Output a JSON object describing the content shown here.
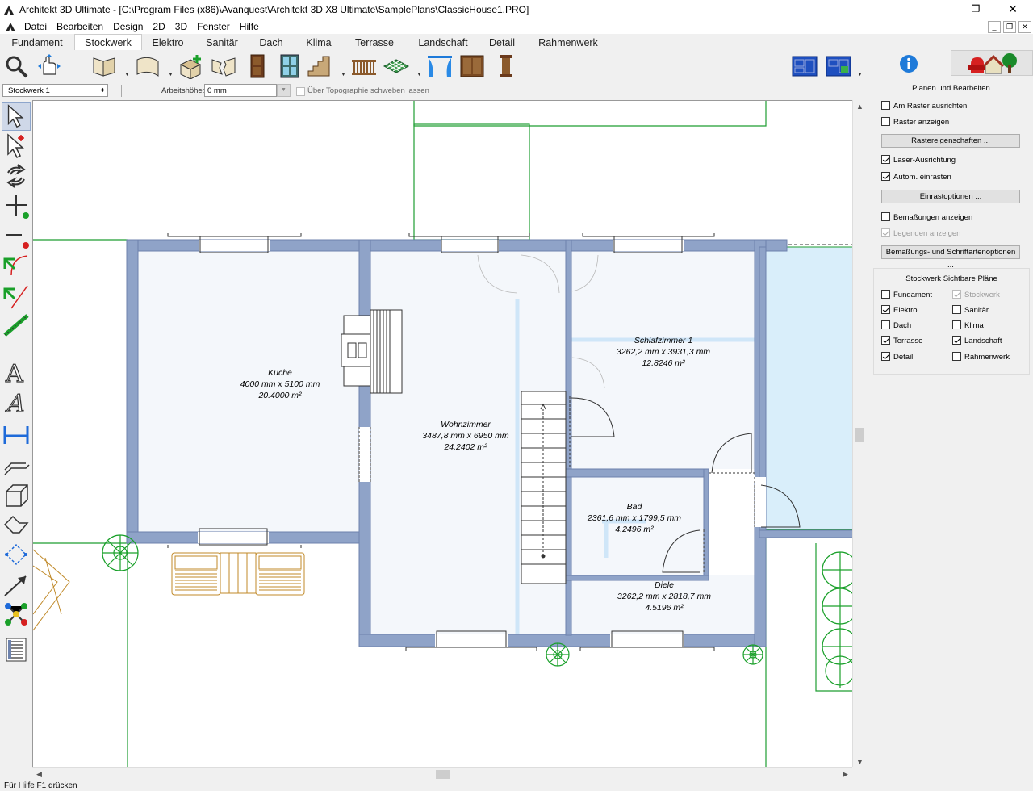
{
  "window": {
    "title": "Architekt 3D Ultimate - [C:\\Program Files (x86)\\Avanquest\\Architekt 3D X8 Ultimate\\SamplePlans\\ClassicHouse1.PRO]",
    "minimize": "—",
    "maximize": "❐",
    "close": "✕"
  },
  "menu": [
    "Datei",
    "Bearbeiten",
    "Design",
    "2D",
    "3D",
    "Fenster",
    "Hilfe"
  ],
  "tabs": [
    {
      "label": "Fundament",
      "active": false
    },
    {
      "label": "Stockwerk",
      "active": true
    },
    {
      "label": "Elektro",
      "active": false
    },
    {
      "label": "Sanitär",
      "active": false
    },
    {
      "label": "Dach",
      "active": false
    },
    {
      "label": "Klima",
      "active": false
    },
    {
      "label": "Terrasse",
      "active": false
    },
    {
      "label": "Landschaft",
      "active": false
    },
    {
      "label": "Detail",
      "active": false
    },
    {
      "label": "Rahmenwerk",
      "active": false
    }
  ],
  "options": {
    "floor_select": "Stockwerk 1",
    "height_label": "Arbeitshöhe:",
    "height_value": "0 mm",
    "topo_label": "Über Topographie schweben lassen"
  },
  "rooms": [
    {
      "name": "Küche",
      "size": "4000 mm x 5100 mm",
      "area": "20.4000 m²"
    },
    {
      "name": "Wohnzimmer",
      "size": "3487,8 mm x 6950 mm",
      "area": "24.2402 m²"
    },
    {
      "name": "Schlafzimmer 1",
      "size": "3262,2 mm x 3931,3 mm",
      "area": "12.8246 m²"
    },
    {
      "name": "Bad",
      "size": "2361,6 mm x 1799,5 mm",
      "area": "4.2496 m²"
    },
    {
      "name": "Diele",
      "size": "3262,2 mm x 2818,7 mm",
      "area": "4.5196 m²"
    }
  ],
  "panel": {
    "section_title": "Planen und Bearbeiten",
    "snap_grid": {
      "label": "Am Raster ausrichten",
      "checked": false
    },
    "show_grid": {
      "label": "Raster anzeigen",
      "checked": false
    },
    "grid_props_btn": "Rastereigenschaften ...",
    "laser": {
      "label": "Laser-Ausrichtung",
      "checked": true
    },
    "auto_snap": {
      "label": "Autom. einrasten",
      "checked": true
    },
    "snap_opts_btn": "Einrastoptionen ...",
    "show_dims": {
      "label": "Bemaßungen anzeigen",
      "checked": false
    },
    "show_legends": {
      "label": "Legenden anzeigen",
      "checked": true
    },
    "dim_font_btn": "Bemaßungs- und Schriftartenoptionen ...",
    "visible_title": "Stockwerk Sichtbare Pläne",
    "plans": [
      {
        "label": "Fundament",
        "checked": false,
        "disabled": false
      },
      {
        "label": "Stockwerk",
        "checked": true,
        "disabled": true
      },
      {
        "label": "Elektro",
        "checked": true,
        "disabled": false
      },
      {
        "label": "Sanitär",
        "checked": false,
        "disabled": false
      },
      {
        "label": "Dach",
        "checked": false,
        "disabled": false
      },
      {
        "label": "Klima",
        "checked": false,
        "disabled": false
      },
      {
        "label": "Terrasse",
        "checked": true,
        "disabled": false
      },
      {
        "label": "Landschaft",
        "checked": true,
        "disabled": false
      },
      {
        "label": "Detail",
        "checked": true,
        "disabled": false
      },
      {
        "label": "Rahmenwerk",
        "checked": false,
        "disabled": false
      }
    ]
  },
  "status": "Für Hilfe F1 drücken",
  "colors": {
    "wall": "#8fa3c8",
    "wall_dark": "#6d82ad",
    "terrain_line": "#1e9e32",
    "tree": "#1aa02a",
    "furniture": "#c08a2a",
    "info_blue": "#1e7ad9"
  }
}
